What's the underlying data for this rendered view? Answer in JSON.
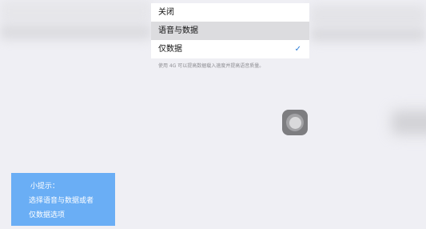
{
  "options": [
    {
      "label": "关闭",
      "highlighted": false,
      "checked": false
    },
    {
      "label": "语音与数据",
      "highlighted": true,
      "checked": false
    },
    {
      "label": "仅数据",
      "highlighted": false,
      "checked": true
    }
  ],
  "checkmark_glyph": "✓",
  "footnote": "使用 4G 可以提高数据载入速度并提高语音质量。",
  "tip": {
    "title": "小提示：",
    "line1": "选择语音与数据或者",
    "line2": "仅数据选项"
  },
  "colors": {
    "background": "#efeff4",
    "check": "#2a7bd6",
    "tip_bg": "#6aaef5",
    "highlight_row": "#dcdcdf"
  },
  "icons": {
    "assistive_touch": "assistive-touch-icon",
    "checkmark": "checkmark-icon"
  }
}
